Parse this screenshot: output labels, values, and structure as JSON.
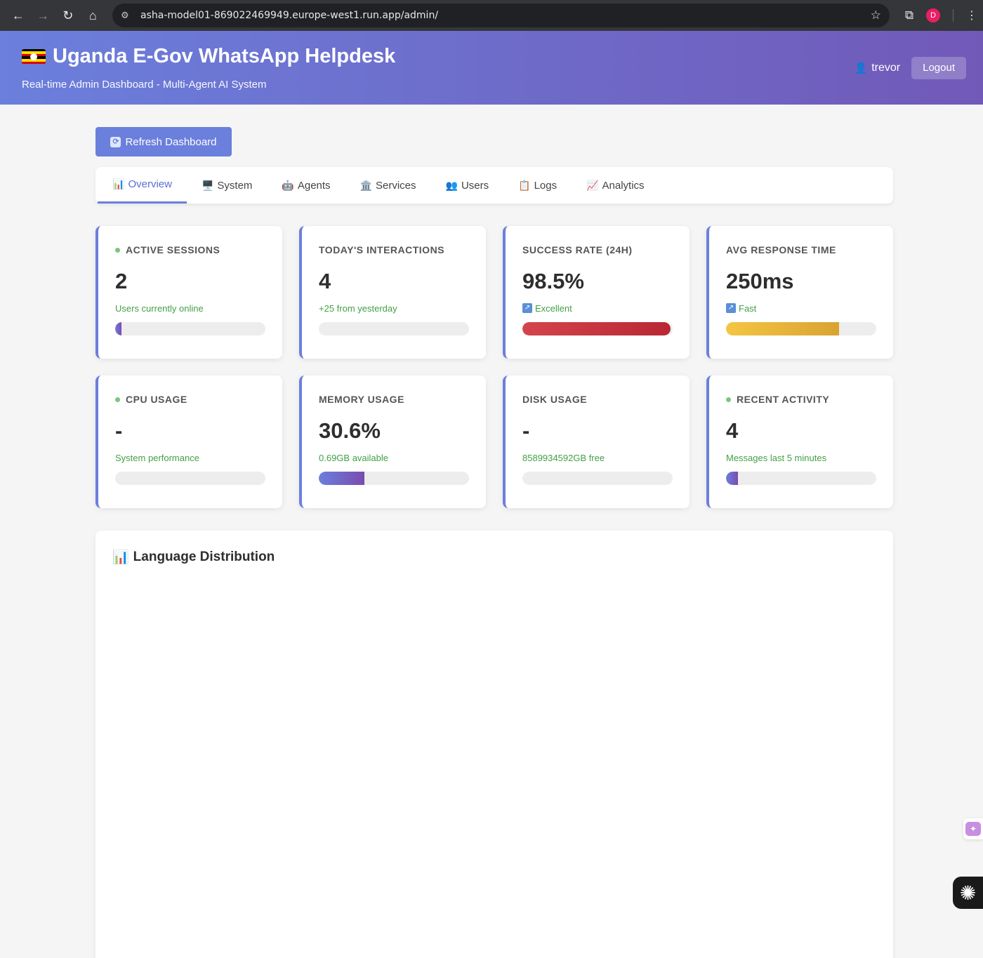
{
  "browser": {
    "url": "asha-model01-869022469949.europe-west1.run.app/admin/",
    "profile_initial": "D"
  },
  "header": {
    "title": "Uganda E-Gov WhatsApp Helpdesk",
    "subtitle": "Real-time Admin Dashboard - Multi-Agent AI System",
    "username": "trevor",
    "logout_label": "Logout"
  },
  "toolbar": {
    "refresh_label": "Refresh Dashboard"
  },
  "tabs": [
    {
      "label": "Overview",
      "icon": "📊"
    },
    {
      "label": "System",
      "icon": "🖥️"
    },
    {
      "label": "Agents",
      "icon": "🤖"
    },
    {
      "label": "Services",
      "icon": "🏛️"
    },
    {
      "label": "Users",
      "icon": "👥"
    },
    {
      "label": "Logs",
      "icon": "📋"
    },
    {
      "label": "Analytics",
      "icon": "📈"
    }
  ],
  "cards": [
    {
      "label": "ACTIVE SESSIONS",
      "value": "2",
      "sub": "Users currently online",
      "progress_percent": 4
    },
    {
      "label": "TODAY'S INTERACTIONS",
      "value": "4",
      "sub": "+25 from yesterday",
      "progress_percent": 0
    },
    {
      "label": "SUCCESS RATE (24H)",
      "value": "98.5%",
      "sub": "Excellent",
      "progress_percent": 98.5
    },
    {
      "label": "AVG RESPONSE TIME",
      "value": "250ms",
      "sub": "Fast",
      "progress_percent": 75
    },
    {
      "label": "CPU USAGE",
      "value": "-",
      "sub": "System performance",
      "progress_percent": 0
    },
    {
      "label": "MEMORY USAGE",
      "value": "30.6%",
      "sub": "0.69GB available",
      "progress_percent": 30.6
    },
    {
      "label": "DISK USAGE",
      "value": "-",
      "sub": "8589934592GB free",
      "progress_percent": 0
    },
    {
      "label": "RECENT ACTIVITY",
      "value": "4",
      "sub": "Messages last 5 minutes",
      "progress_percent": 8
    }
  ],
  "language_panel": {
    "title": "Language Distribution",
    "icon": "📊"
  },
  "colors": {
    "accent": "#6b7fdc",
    "header_end": "#7159b8",
    "success_text": "#43a047",
    "danger_fill": "#c8343d",
    "warning_fill": "#e8b93d"
  }
}
